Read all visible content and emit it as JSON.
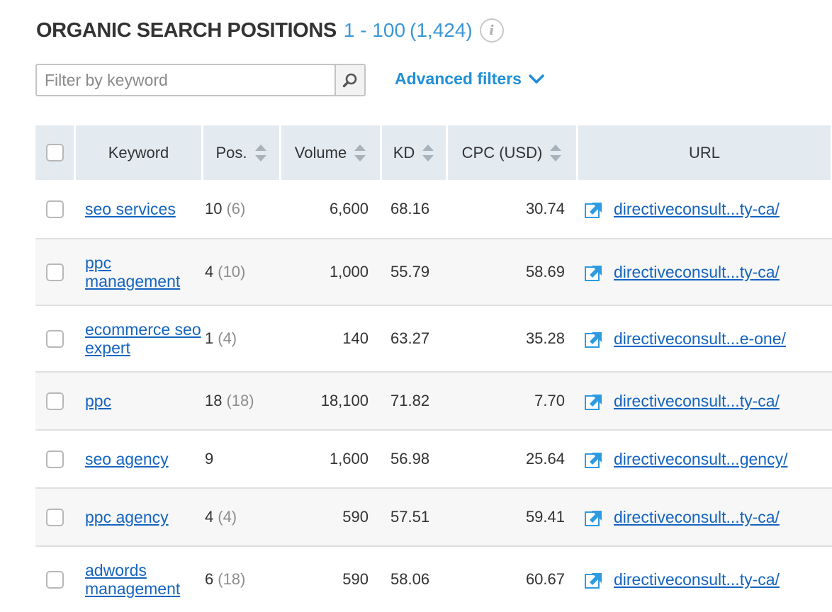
{
  "header": {
    "title": "ORGANIC SEARCH POSITIONS",
    "range": "1 - 100",
    "total": "(1,424)",
    "info_icon": "info-icon"
  },
  "filter": {
    "placeholder": "Filter by keyword",
    "value": "",
    "search_icon": "search-icon",
    "advanced_label": "Advanced filters",
    "advanced_icon": "chevron-down-icon"
  },
  "table": {
    "columns": [
      "Keyword",
      "Pos.",
      "Volume",
      "KD",
      "CPC (USD)",
      "URL"
    ],
    "sortable": [
      false,
      true,
      true,
      true,
      true,
      false
    ],
    "rows": [
      {
        "keyword": "seo services",
        "pos": "10",
        "pos_prev": "(6)",
        "volume": "6,600",
        "kd": "68.16",
        "cpc": "30.74",
        "url": "directiveconsult...ty-ca/"
      },
      {
        "keyword": "ppc management",
        "pos": "4",
        "pos_prev": "(10)",
        "volume": "1,000",
        "kd": "55.79",
        "cpc": "58.69",
        "url": "directiveconsult...ty-ca/"
      },
      {
        "keyword": "ecommerce seo expert",
        "pos": "1",
        "pos_prev": "(4)",
        "volume": "140",
        "kd": "63.27",
        "cpc": "35.28",
        "url": "directiveconsult...e-one/"
      },
      {
        "keyword": "ppc",
        "pos": "18",
        "pos_prev": "(18)",
        "volume": "18,100",
        "kd": "71.82",
        "cpc": "7.70",
        "url": "directiveconsult...ty-ca/"
      },
      {
        "keyword": "seo agency",
        "pos": "9",
        "pos_prev": "",
        "volume": "1,600",
        "kd": "56.98",
        "cpc": "25.64",
        "url": "directiveconsult...gency/"
      },
      {
        "keyword": "ppc agency",
        "pos": "4",
        "pos_prev": "(4)",
        "volume": "590",
        "kd": "57.51",
        "cpc": "59.41",
        "url": "directiveconsult...ty-ca/"
      },
      {
        "keyword": "adwords management",
        "pos": "6",
        "pos_prev": "(18)",
        "volume": "590",
        "kd": "58.06",
        "cpc": "60.67",
        "url": "directiveconsult...ty-ca/"
      }
    ]
  },
  "colors": {
    "accent": "#1f8fd8",
    "link": "#1564c0",
    "header_bg": "#e3ebf1",
    "muted": "#8d8d8d"
  }
}
